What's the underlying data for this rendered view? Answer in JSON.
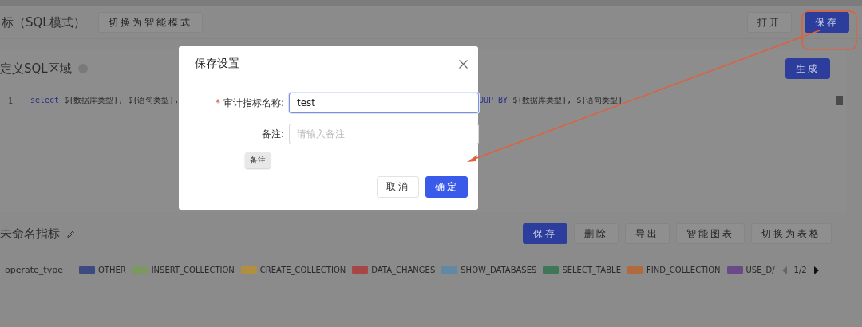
{
  "header": {
    "title": "标（SQL模式）",
    "mode_button": "切换为智能模式",
    "actions": [
      {
        "label": "打开",
        "primary": false
      },
      {
        "label": "保存",
        "primary": true
      }
    ]
  },
  "sql_panel": {
    "title": "定义SQL区域",
    "generate_button": "生成",
    "line_number": "1",
    "segments": [
      [
        {
          "kind": "keyword",
          "text": "select"
        },
        {
          "kind": "plain",
          "text": " ${数据库类型}, ${语句类型},"
        }
      ],
      [
        {
          "kind": "keyword",
          "text": "OUP BY"
        },
        {
          "kind": "plain",
          "text": " ${数据库类型}, ${语句类型}"
        }
      ]
    ]
  },
  "dialog": {
    "title": "保存设置",
    "fields": [
      {
        "label": "审计指标名称:",
        "required_mark": "*",
        "value": "test",
        "focused": true
      },
      {
        "label": "备注:",
        "placeholder": "请输入备注",
        "focused": false
      }
    ],
    "tooltip": "备注",
    "buttons": [
      {
        "label": "取消",
        "primary": false
      },
      {
        "label": "确定",
        "primary": true
      }
    ]
  },
  "metric_panel": {
    "title": "未命名指标",
    "buttons": [
      {
        "label": "保存",
        "primary": true
      },
      {
        "label": "删除",
        "primary": false
      },
      {
        "label": "导出",
        "primary": false
      },
      {
        "label": "智能图表",
        "primary": false
      },
      {
        "label": "切换为表格",
        "primary": false
      }
    ],
    "legend": {
      "title": "operate_type",
      "items": [
        {
          "label": "OTHER",
          "color": "#3c4a80"
        },
        {
          "label": "INSERT_COLLECTION",
          "color": "#7a9860"
        },
        {
          "label": "CREATE_COLLECTION",
          "color": "#b0903e"
        },
        {
          "label": "DATA_CHANGES",
          "color": "#a84646"
        },
        {
          "label": "SHOW_DATABASES",
          "color": "#6089a3"
        },
        {
          "label": "SELECT_TABLE",
          "color": "#3e7656"
        },
        {
          "label": "FIND_COLLECTION",
          "color": "#b06a3e"
        },
        {
          "label": "USE_D/",
          "color": "#6a4a86"
        }
      ],
      "page": "1/2"
    }
  }
}
